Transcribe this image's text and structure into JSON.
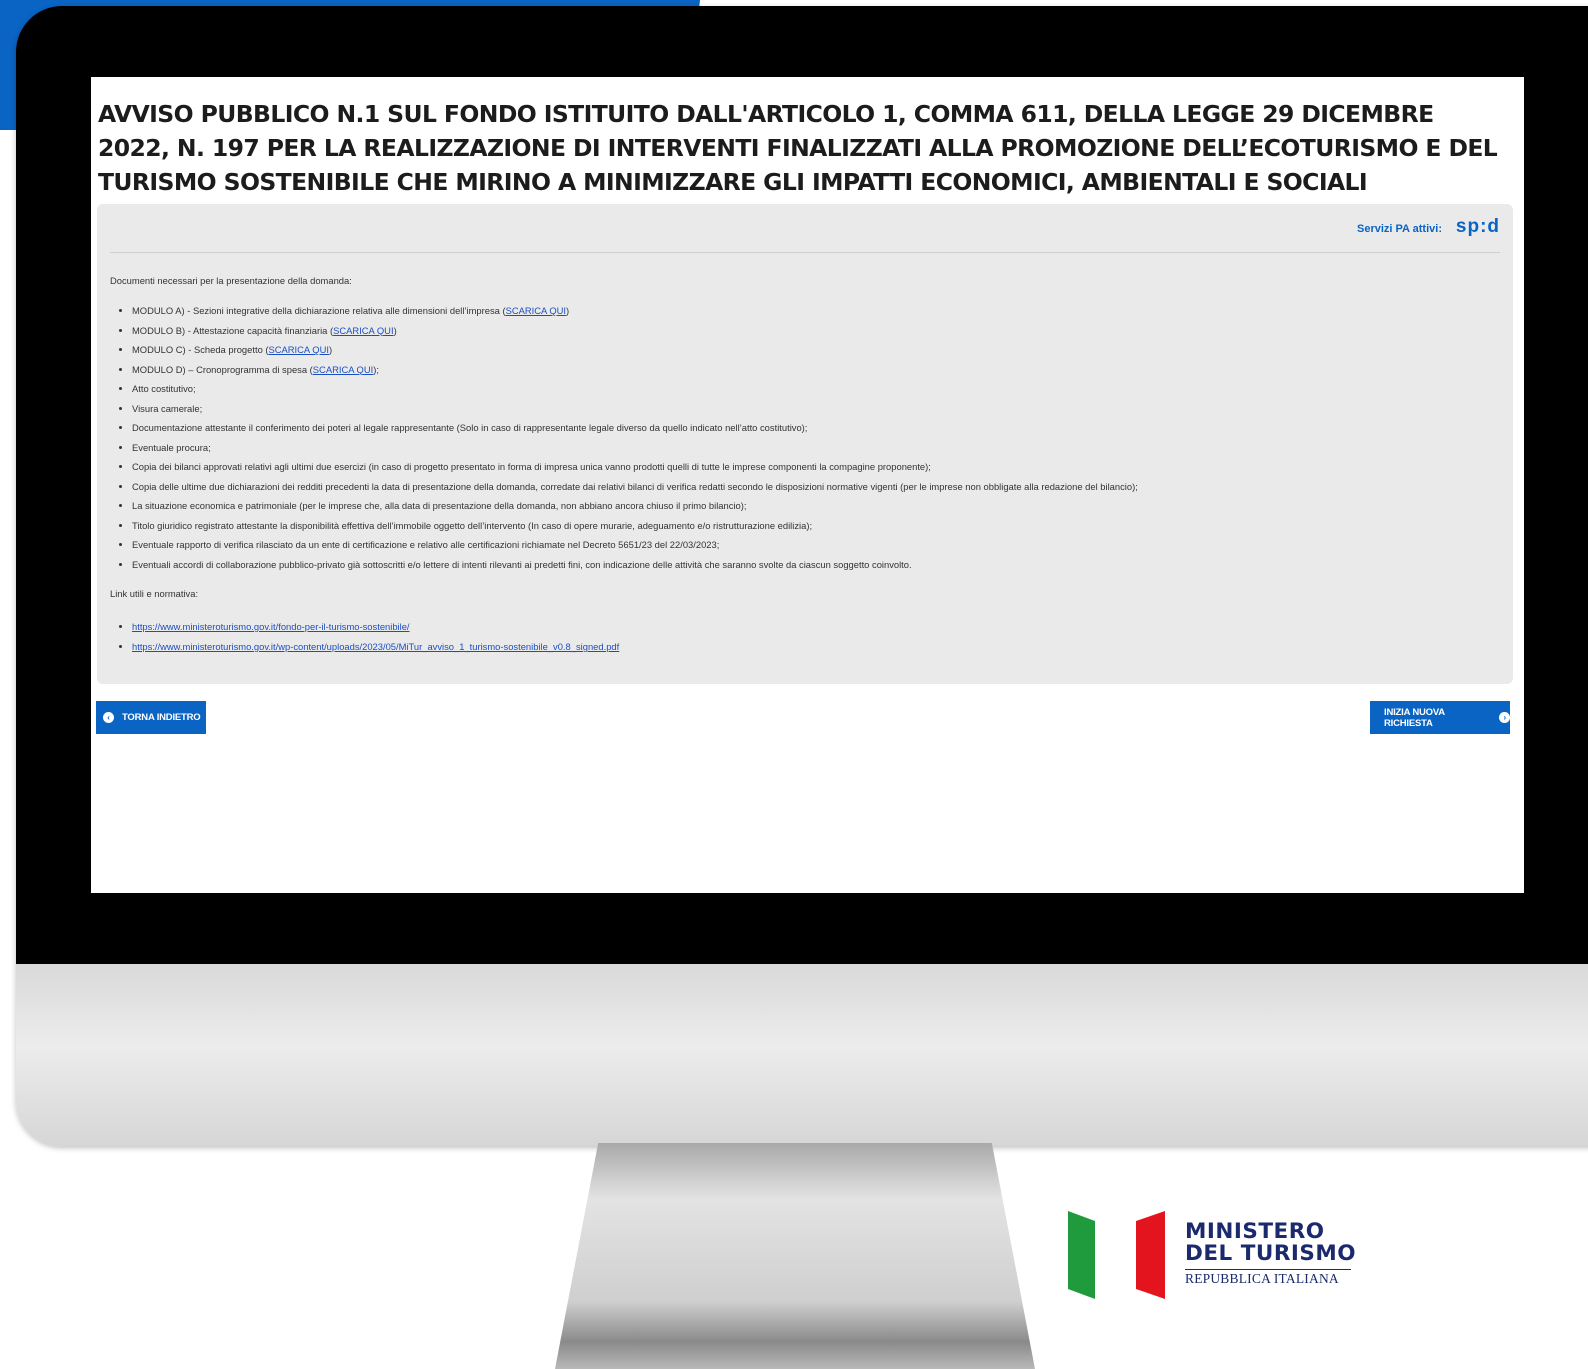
{
  "page": {
    "title": "AVVISO PUBBLICO N.1 SUL FONDO ISTITUITO DALL'ARTICOLO 1, COMMA 611, DELLA LEGGE 29 DICEMBRE 2022, N. 197 PER LA REALIZZAZIONE DI INTERVENTI FINALIZZATI ALLA PROMOZIONE DELL’ECOTURISMO E DEL TURISMO SOSTENIBILE CHE MIRINO A MINIMIZZARE GLI IMPATTI ECONOMICI, AMBIENTALI E SOCIALI"
  },
  "header": {
    "services_label": "Servizi PA attivi:",
    "spid_logo": "sp:d"
  },
  "documents": {
    "intro": "Documenti necessari per la presentazione della domanda:",
    "items": [
      {
        "pre": "MODULO A) - Sezioni integrative della dichiarazione relativa alle dimensioni dell’impresa (",
        "link": "SCARICA QUI",
        "post": ")"
      },
      {
        "pre": "MODULO B) - Attestazione capacità finanziaria (",
        "link": "SCARICA QUI",
        "post": ")"
      },
      {
        "pre": "MODULO C) - Scheda progetto (",
        "link": "SCARICA QUI",
        "post": ")"
      },
      {
        "pre": "MODULO D) – Cronoprogramma di spesa (",
        "link": "SCARICA QUI",
        "post": ");"
      },
      {
        "text": "Atto costitutivo;"
      },
      {
        "text": "Visura camerale;"
      },
      {
        "text": "Documentazione attestante il conferimento dei poteri al legale rappresentante (Solo in caso di rappresentante legale diverso da quello indicato nell’atto costitutivo);"
      },
      {
        "text": "Eventuale procura;"
      },
      {
        "text": "Copia dei bilanci approvati relativi agli ultimi due esercizi (in caso di progetto presentato in forma di impresa unica vanno prodotti quelli di tutte le imprese componenti la compagine proponente);"
      },
      {
        "text": "Copia delle ultime due dichiarazioni dei redditi precedenti la data di presentazione della domanda, corredate dai relativi bilanci di verifica redatti secondo le disposizioni normative vigenti (per le imprese non obbligate alla redazione del bilancio);"
      },
      {
        "text": "La situazione economica e patrimoniale (per le imprese che, alla data di presentazione della domanda, non abbiano ancora chiuso il primo bilancio);"
      },
      {
        "text": "Titolo giuridico registrato attestante la disponibilità effettiva dell’immobile oggetto dell’intervento (In caso di opere murarie, adeguamento e/o ristrutturazione edilizia);"
      },
      {
        "text": "Eventuale rapporto di verifica rilasciato da un ente di certificazione e relativo alle certificazioni richiamate nel Decreto 5651/23 del 22/03/2023;"
      },
      {
        "text": "Eventuali accordi di collaborazione pubblico-privato già sottoscritti e/o lettere di intenti rilevanti ai predetti fini, con indicazione delle attività che saranno svolte da ciascun soggetto coinvolto."
      }
    ]
  },
  "links": {
    "intro": "Link utili e normativa:",
    "items": [
      "https://www.ministeroturismo.gov.it/fondo-per-il-turismo-sostenibile/",
      "https://www.ministeroturismo.gov.it/wp-content/uploads/2023/05/MiTur_avviso_1_turismo-sostenibile_v0.8_signed.pdf"
    ]
  },
  "buttons": {
    "back_label": "TORNA INDIETRO",
    "new_label": "INIZIA NUOVA RICHIESTA"
  },
  "logo": {
    "line1": "MINISTERO",
    "line2": "DEL TURISMO",
    "line3": "REPUBBLICA ITALIANA"
  },
  "colors": {
    "accent": "#0a64c4",
    "flag_green": "#1f9a3c",
    "flag_red": "#e3141e",
    "logo_text": "#1a2a6c"
  }
}
